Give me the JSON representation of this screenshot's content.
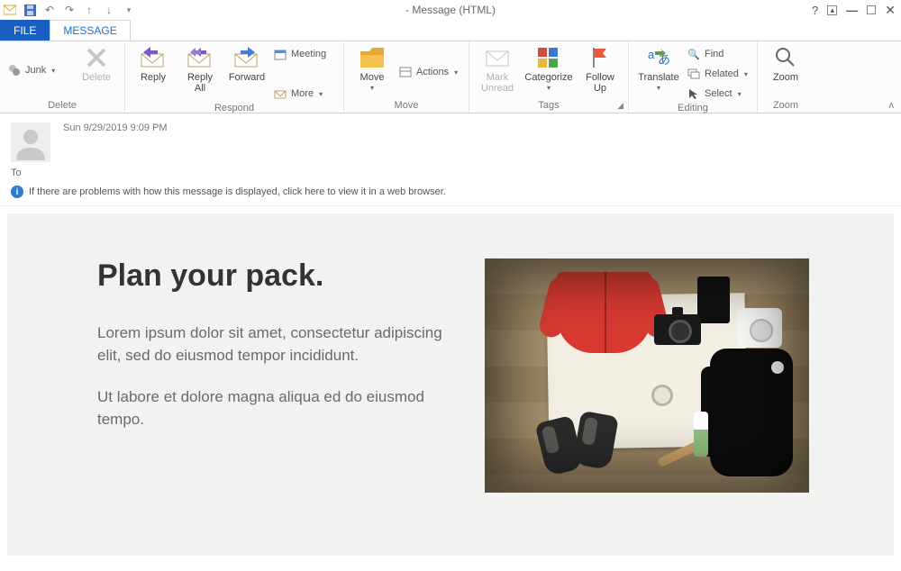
{
  "titlebar": {
    "title": "- Message (HTML)"
  },
  "qat": {
    "undo_tip": "Undo",
    "redo_tip": "Redo"
  },
  "tabs": {
    "file": "FILE",
    "message": "MESSAGE"
  },
  "ribbon": {
    "delete": {
      "junk": "Junk",
      "delete": "Delete",
      "group": "Delete"
    },
    "respond": {
      "reply": "Reply",
      "reply_all": "Reply\nAll",
      "forward": "Forward",
      "meeting": "Meeting",
      "more": "More",
      "group": "Respond"
    },
    "move": {
      "move": "Move",
      "actions": "Actions",
      "group": "Move"
    },
    "tags": {
      "mark_unread": "Mark\nUnread",
      "categorize": "Categorize",
      "follow_up": "Follow\nUp",
      "group": "Tags"
    },
    "editing": {
      "translate": "Translate",
      "find": "Find",
      "related": "Related",
      "select": "Select",
      "group": "Editing"
    },
    "zoom": {
      "zoom": "Zoom",
      "group": "Zoom"
    }
  },
  "message": {
    "date": "Sun 9/29/2019 9:09 PM",
    "to_label": "To",
    "info": "If there are problems with how this message is displayed, click here to view it in a web browser."
  },
  "email": {
    "heading": "Plan your pack.",
    "para1": "Lorem ipsum dolor sit amet, consectetur adipiscing elit, sed do eiusmod tempor incididunt.",
    "para2": "Ut labore et dolore magna aliqua ed do eiusmod tempo."
  }
}
